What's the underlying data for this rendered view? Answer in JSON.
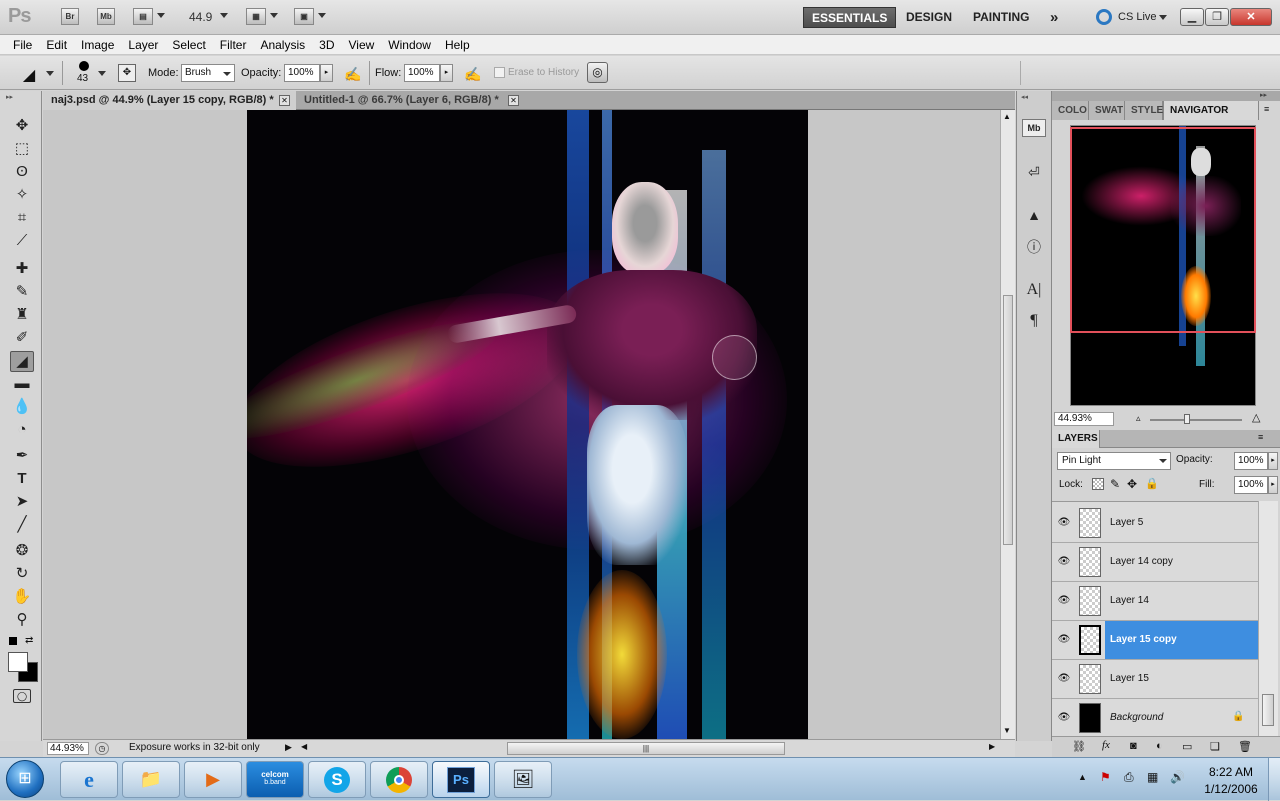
{
  "app": {
    "logo": "Ps",
    "bridge": "Br",
    "minibridge": "Mb",
    "zoom_value": "44.9"
  },
  "workspaces": {
    "essentials": "ESSENTIALS",
    "design": "DESIGN",
    "painting": "PAINTING",
    "more": "»",
    "cslive": "CS Live"
  },
  "menu": [
    "File",
    "Edit",
    "Image",
    "Layer",
    "Select",
    "Filter",
    "Analysis",
    "3D",
    "View",
    "Window",
    "Help"
  ],
  "options": {
    "brush_size": "43",
    "mode_label": "Mode:",
    "mode_value": "Brush",
    "opacity_label": "Opacity:",
    "opacity_value": "100%",
    "flow_label": "Flow:",
    "flow_value": "100%",
    "erase_history": "Erase to History"
  },
  "documents": [
    {
      "title": "naj3.psd @ 44.9% (Layer 15 copy, RGB/8) *",
      "active": true
    },
    {
      "title": "Untitled-1 @ 66.7% (Layer 6, RGB/8) *",
      "active": false
    }
  ],
  "status": {
    "zoom": "44.93%",
    "message": "Exposure works in 32-bit only"
  },
  "panel_tabs": [
    "COLO",
    "SWAT",
    "STYLE",
    "NAVIGATOR"
  ],
  "navigator": {
    "zoom": "44.93%"
  },
  "layers": {
    "tab": "LAYERS",
    "blend_mode": "Pin Light",
    "opacity_label": "Opacity:",
    "opacity_value": "100%",
    "lock_label": "Lock:",
    "fill_label": "Fill:",
    "fill_value": "100%",
    "items": [
      {
        "name": "Layer 5",
        "selected": false
      },
      {
        "name": "Layer 14 copy",
        "selected": false
      },
      {
        "name": "Layer 14",
        "selected": false
      },
      {
        "name": "Layer 15 copy",
        "selected": true
      },
      {
        "name": "Layer 15",
        "selected": false
      },
      {
        "name": "Background",
        "selected": false
      }
    ]
  },
  "taskbar": {
    "time": "8:22 AM",
    "date": "1/12/2006",
    "celcom_line1": "celcom",
    "celcom_line2": "b.band",
    "ps_label": "Ps"
  },
  "colors": {
    "accent_selected_layer": "#3e8ee0",
    "essentials_active": "#555555",
    "close_button": "#c8372d"
  }
}
